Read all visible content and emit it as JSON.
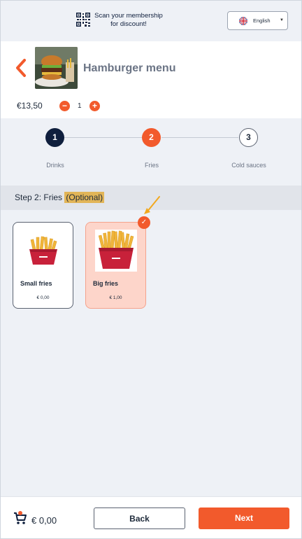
{
  "topbar": {
    "scan_text": "Scan your membership for discount!",
    "qr_icon": "qr-code-icon",
    "language": {
      "label": "English",
      "flag_icon": "uk-flag-icon",
      "caret_icon": "caret-down-icon"
    }
  },
  "product": {
    "title": "Hamburger menu",
    "price": "€13,50",
    "quantity": "1",
    "back_icon": "chevron-left-icon",
    "minus_label": "−",
    "plus_label": "+"
  },
  "stepper": {
    "steps": [
      {
        "number": "1",
        "label": "Drinks",
        "state": "done"
      },
      {
        "number": "2",
        "label": "Fries",
        "state": "active"
      },
      {
        "number": "3",
        "label": "Cold sauces",
        "state": "upcoming"
      }
    ]
  },
  "step_header": {
    "prefix": "Step 2: Fries",
    "optional": "(Optional)"
  },
  "options": [
    {
      "name": "Small fries",
      "price": "€ 0,00",
      "selected": false
    },
    {
      "name": "Big fries",
      "price": "€ 1,00",
      "selected": true
    }
  ],
  "selected_check": "✓",
  "footer": {
    "cart_icon": "cart-icon",
    "total": "€ 0,00",
    "back_label": "Back",
    "next_label": "Next"
  },
  "colors": {
    "accent": "#f25a2c",
    "navy": "#0f1f3d",
    "selected_card": "#fdd5ca",
    "highlight": "#e2b558"
  }
}
